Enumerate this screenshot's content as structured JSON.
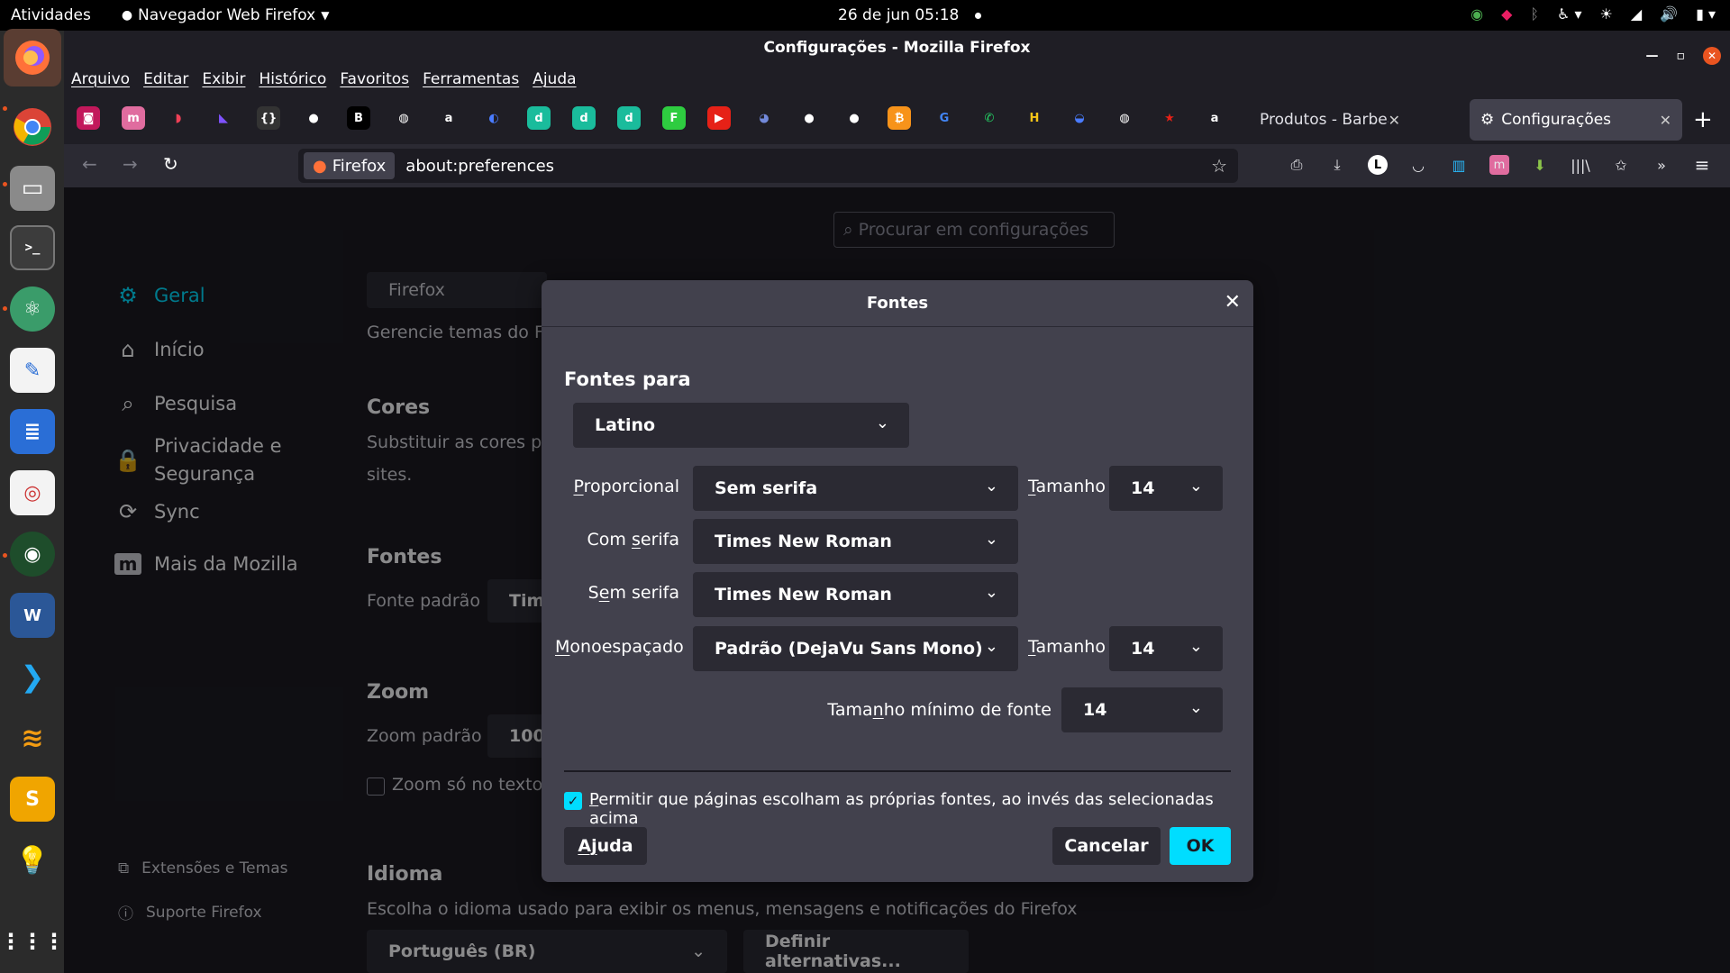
{
  "topbar": {
    "activities": "Atividades",
    "app_menu": "Navegador Web Firefox",
    "clock": "26 de jun  05:18"
  },
  "dock": {
    "apps": [
      "firefox",
      "chrome",
      "files",
      "terminal",
      "atom",
      "text-editor",
      "libreoffice-writer",
      "document-viewer",
      "camera",
      "word-online",
      "vscode",
      "layers",
      "sublime",
      "lightbulb",
      "apps-grid"
    ]
  },
  "window": {
    "title": "Configurações - Mozilla Firefox"
  },
  "menubar": {
    "items": [
      "Arquivo",
      "Editar",
      "Exibir",
      "Histórico",
      "Favoritos",
      "Ferramentas",
      "Ajuda"
    ]
  },
  "tabs": [
    {
      "label": "Produtos - Barbearia Al..."
    },
    {
      "label": "Configurações"
    }
  ],
  "navbar": {
    "identity": "Firefox",
    "url": "about:preferences"
  },
  "prefs": {
    "search_placeholder": "Procurar em configurações",
    "nav": [
      "Geral",
      "Início",
      "Pesquisa",
      "Privacidade e",
      "Segurança",
      "Sync",
      "Mais da Mozilla"
    ],
    "nav_bottom": [
      "Extensões e Temas",
      "Suporte Firefox"
    ],
    "theme_value": "Firefox",
    "theme_desc": "Gerencie temas do Fi",
    "colors_heading": "Cores",
    "colors_desc_1": "Substituir as cores pa",
    "colors_desc_2": "sites.",
    "fonts_heading": "Fontes",
    "default_font_label": "Fonte padrão",
    "default_font_value": "Tim",
    "zoom_heading": "Zoom",
    "zoom_label": "Zoom padrão",
    "zoom_value": "100",
    "zoom_text_only": "Zoom só no texto",
    "language_heading": "Idioma",
    "language_desc": "Escolha o idioma usado para exibir os menus, mensagens e notificações do Firefox",
    "language_value": "Português (BR)",
    "alternatives_button": "Definir alternativas..."
  },
  "dialog": {
    "title": "Fontes",
    "fonts_for_label": "Fontes para",
    "script_value": "Latino",
    "proportional_label_u": "P",
    "proportional_label_rest": "roporcional",
    "proportional_value": "Sem serifa",
    "size_label_u": "T",
    "size_label_rest": "amanho",
    "proportional_size": "14",
    "serif_label_pre": "Com ",
    "serif_label_u": "s",
    "serif_label_rest": "erifa",
    "serif_value": "Times New Roman",
    "sans_label_pre": "S",
    "sans_label_u": "e",
    "sans_label_rest": "m serifa",
    "sans_value": "Times New Roman",
    "mono_label_u": "M",
    "mono_label_rest": "onoespaçado",
    "mono_value": "Padrão (DejaVu Sans Mono)",
    "mono_size": "14",
    "min_size_label_pre": "Tama",
    "min_size_label_u": "n",
    "min_size_label_rest": "ho mínimo de fonte",
    "min_size_value": "14",
    "allow_label_u": "P",
    "allow_label_rest": "ermitir que páginas escolham as próprias fontes, ao invés das selecionadas acima",
    "help_u": "Aj",
    "help_rest": "uda",
    "cancel": "Cancelar",
    "ok": "OK"
  },
  "colors": {
    "accent": "#00ddff",
    "dialog_bg": "#42414d",
    "page_bg": "#1c1b22"
  }
}
